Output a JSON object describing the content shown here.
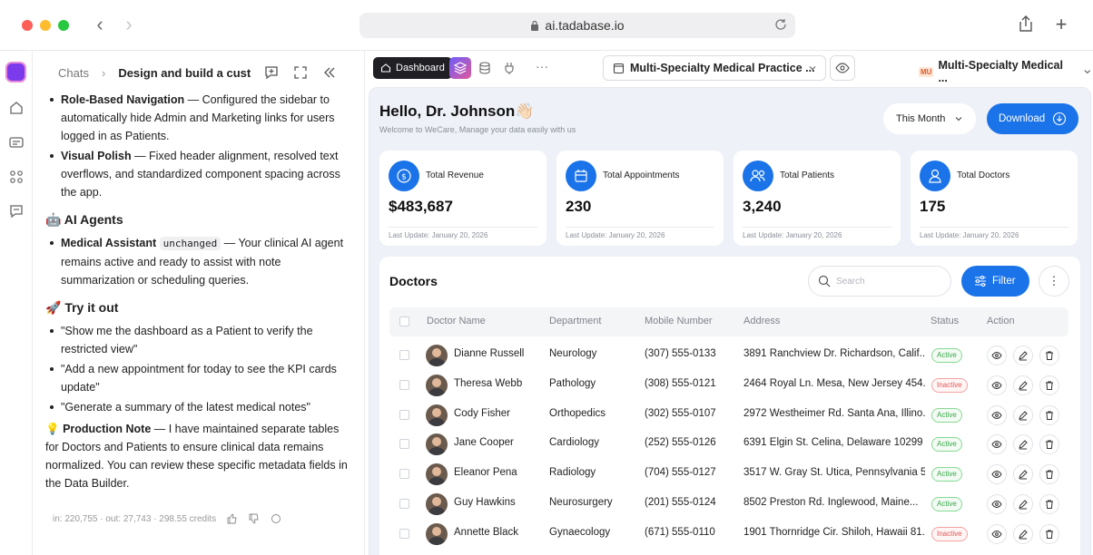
{
  "browser": {
    "url": "ai.tadabase.io"
  },
  "chat": {
    "breadcrumb_root": "Chats",
    "breadcrumb_current": "Design and build a custon",
    "bullets_top": [
      {
        "bold": "Role-Based Navigation",
        "text": " — Configured the sidebar to automatically hide Admin and Marketing links for users logged in as Patients."
      },
      {
        "bold": "Visual Polish",
        "text": " — Fixed header alignment, resolved text overflows, and standardized component spacing across the app."
      }
    ],
    "ai_heading": "🤖 AI Agents",
    "ai_bullet_bold": "Medical Assistant",
    "ai_bullet_code": "unchanged",
    "ai_bullet_text": " — Your clinical AI agent remains active and ready to assist with note summarization or scheduling queries.",
    "try_heading": "🚀 Try it out",
    "try_items": [
      "\"Show me the dashboard as a Patient to verify the restricted view\"",
      "\"Add a new appointment for today to see the KPI cards update\"",
      "\"Generate a summary of the latest medical notes\""
    ],
    "note_icon": "💡",
    "note_bold": "Production Note",
    "note_text": " — I have maintained separate tables for Doctors and Patients to ensure clinical data remains normalized. You can review these specific metadata fields in the Data Builder.",
    "meta": "in: 220,755 · out: 27,743 · 298.55 credits"
  },
  "toolbar": {
    "dashboard_label": "Dashboard",
    "more": "···",
    "page_select": "Multi-Specialty Medical Practice ...",
    "app_badge": "MU",
    "app_name": "Multi-Specialty Medical ..."
  },
  "dashboard": {
    "greeting": "Hello, Dr. Johnson👋🏻",
    "subtitle": "Welcome to WeCare, Manage your data easily with us",
    "period": "This Month",
    "download_label": "Download",
    "kpis": [
      {
        "label": "Total Revenue",
        "value": "$483,687",
        "updated": "Last Update: January 20, 2026",
        "icon": "dollar-icon"
      },
      {
        "label": "Total Appointments",
        "value": "230",
        "updated": "Last Update: January 20, 2026",
        "icon": "calendar-icon"
      },
      {
        "label": "Total Patients",
        "value": "3,240",
        "updated": "Last Update: January 20, 2026",
        "icon": "users-icon"
      },
      {
        "label": "Total Doctors",
        "value": "175",
        "updated": "Last Update: January 20, 2026",
        "icon": "user-icon"
      }
    ],
    "accent": "#1a73e8"
  },
  "doctors": {
    "title": "Doctors",
    "search_placeholder": "Search",
    "filter_label": "Filter",
    "columns": [
      "Doctor Name",
      "Department",
      "Mobile Number",
      "Address",
      "Status",
      "Action"
    ],
    "rows": [
      {
        "name": "Dianne Russell",
        "department": "Neurology",
        "mobile": "(307) 555-0133",
        "address": "3891 Ranchview Dr. Richardson, Calif...",
        "status": "Active"
      },
      {
        "name": "Theresa Webb",
        "department": "Pathology",
        "mobile": "(308) 555-0121",
        "address": "2464 Royal Ln. Mesa, New Jersey 454...",
        "status": "Inactive"
      },
      {
        "name": "Cody Fisher",
        "department": "Orthopedics",
        "mobile": "(302) 555-0107",
        "address": "2972 Westheimer Rd. Santa Ana, Illino...",
        "status": "Active"
      },
      {
        "name": "Jane Cooper",
        "department": "Cardiology",
        "mobile": "(252) 555-0126",
        "address": "6391 Elgin St. Celina, Delaware 10299",
        "status": "Active"
      },
      {
        "name": "Eleanor Pena",
        "department": "Radiology",
        "mobile": "(704) 555-0127",
        "address": "3517 W. Gray St. Utica, Pennsylvania 5...",
        "status": "Active"
      },
      {
        "name": "Guy Hawkins",
        "department": "Neurosurgery",
        "mobile": "(201) 555-0124",
        "address": "8502 Preston Rd. Inglewood, Maine...",
        "status": "Active"
      },
      {
        "name": "Annette Black",
        "department": "Gynaecology",
        "mobile": "(671) 555-0110",
        "address": "1901 Thornridge Cir. Shiloh, Hawaii 81...",
        "status": "Inactive"
      }
    ]
  }
}
